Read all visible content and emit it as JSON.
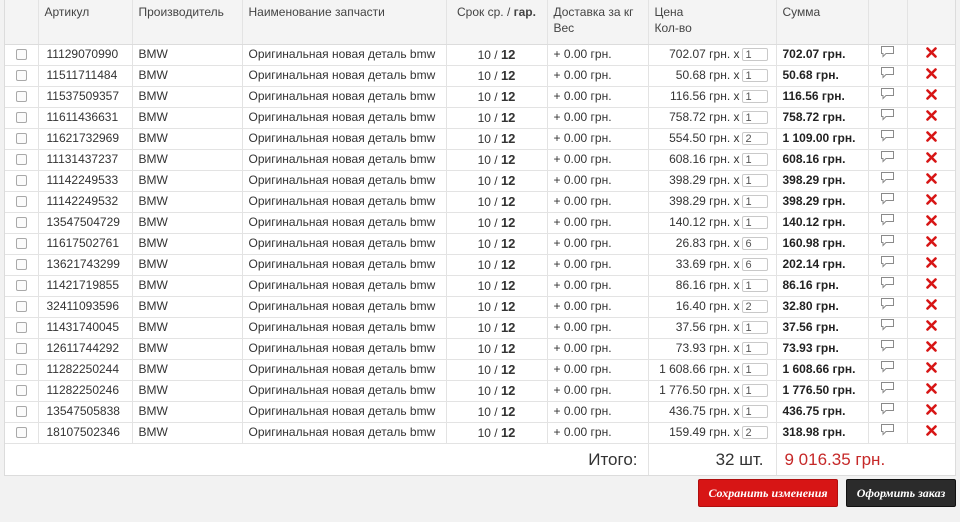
{
  "columns": {
    "article": "Артикул",
    "manufacturer": "Производитель",
    "name": "Наименование запчасти",
    "term_prefix": "Срок ср. / ",
    "term_bold": "гар.",
    "delivery": "Доставка за кг",
    "weight": "Вес",
    "price": "Цена",
    "qty": "Кол-во",
    "sum": "Сумма"
  },
  "rows": [
    {
      "article": "11129070990",
      "maker": "BMW",
      "name": "Оригинальная новая деталь bmw",
      "term_avg": "10",
      "term_gar": "12",
      "delivery": "+ 0.00 грн.",
      "price": "702.07 грн. x",
      "qty": "1",
      "sum": "702.07 грн."
    },
    {
      "article": "11511711484",
      "maker": "BMW",
      "name": "Оригинальная новая деталь bmw",
      "term_avg": "10",
      "term_gar": "12",
      "delivery": "+ 0.00 грн.",
      "price": "50.68 грн. x",
      "qty": "1",
      "sum": "50.68 грн."
    },
    {
      "article": "11537509357",
      "maker": "BMW",
      "name": "Оригинальная новая деталь bmw",
      "term_avg": "10",
      "term_gar": "12",
      "delivery": "+ 0.00 грн.",
      "price": "116.56 грн. x",
      "qty": "1",
      "sum": "116.56 грн."
    },
    {
      "article": "11611436631",
      "maker": "BMW",
      "name": "Оригинальная новая деталь bmw",
      "term_avg": "10",
      "term_gar": "12",
      "delivery": "+ 0.00 грн.",
      "price": "758.72 грн. x",
      "qty": "1",
      "sum": "758.72 грн."
    },
    {
      "article": "11621732969",
      "maker": "BMW",
      "name": "Оригинальная новая деталь bmw",
      "term_avg": "10",
      "term_gar": "12",
      "delivery": "+ 0.00 грн.",
      "price": "554.50 грн. x",
      "qty": "2",
      "sum": "1 109.00 грн."
    },
    {
      "article": "11131437237",
      "maker": "BMW",
      "name": "Оригинальная новая деталь bmw",
      "term_avg": "10",
      "term_gar": "12",
      "delivery": "+ 0.00 грн.",
      "price": "608.16 грн. x",
      "qty": "1",
      "sum": "608.16 грн."
    },
    {
      "article": "11142249533",
      "maker": "BMW",
      "name": "Оригинальная новая деталь bmw",
      "term_avg": "10",
      "term_gar": "12",
      "delivery": "+ 0.00 грн.",
      "price": "398.29 грн. x",
      "qty": "1",
      "sum": "398.29 грн."
    },
    {
      "article": "11142249532",
      "maker": "BMW",
      "name": "Оригинальная новая деталь bmw",
      "term_avg": "10",
      "term_gar": "12",
      "delivery": "+ 0.00 грн.",
      "price": "398.29 грн. x",
      "qty": "1",
      "sum": "398.29 грн."
    },
    {
      "article": "13547504729",
      "maker": "BMW",
      "name": "Оригинальная новая деталь bmw",
      "term_avg": "10",
      "term_gar": "12",
      "delivery": "+ 0.00 грн.",
      "price": "140.12 грн. x",
      "qty": "1",
      "sum": "140.12 грн."
    },
    {
      "article": "11617502761",
      "maker": "BMW",
      "name": "Оригинальная новая деталь bmw",
      "term_avg": "10",
      "term_gar": "12",
      "delivery": "+ 0.00 грн.",
      "price": "26.83 грн. x",
      "qty": "6",
      "sum": "160.98 грн."
    },
    {
      "article": "13621743299",
      "maker": "BMW",
      "name": "Оригинальная новая деталь bmw",
      "term_avg": "10",
      "term_gar": "12",
      "delivery": "+ 0.00 грн.",
      "price": "33.69 грн. x",
      "qty": "6",
      "sum": "202.14 грн."
    },
    {
      "article": "11421719855",
      "maker": "BMW",
      "name": "Оригинальная новая деталь bmw",
      "term_avg": "10",
      "term_gar": "12",
      "delivery": "+ 0.00 грн.",
      "price": "86.16 грн. x",
      "qty": "1",
      "sum": "86.16 грн."
    },
    {
      "article": "32411093596",
      "maker": "BMW",
      "name": "Оригинальная новая деталь bmw",
      "term_avg": "10",
      "term_gar": "12",
      "delivery": "+ 0.00 грн.",
      "price": "16.40 грн. x",
      "qty": "2",
      "sum": "32.80 грн."
    },
    {
      "article": "11431740045",
      "maker": "BMW",
      "name": "Оригинальная новая деталь bmw",
      "term_avg": "10",
      "term_gar": "12",
      "delivery": "+ 0.00 грн.",
      "price": "37.56 грн. x",
      "qty": "1",
      "sum": "37.56 грн."
    },
    {
      "article": "12611744292",
      "maker": "BMW",
      "name": "Оригинальная новая деталь bmw",
      "term_avg": "10",
      "term_gar": "12",
      "delivery": "+ 0.00 грн.",
      "price": "73.93 грн. x",
      "qty": "1",
      "sum": "73.93 грн."
    },
    {
      "article": "11282250244",
      "maker": "BMW",
      "name": "Оригинальная новая деталь bmw",
      "term_avg": "10",
      "term_gar": "12",
      "delivery": "+ 0.00 грн.",
      "price": "1 608.66 грн. x",
      "qty": "1",
      "sum": "1 608.66 грн."
    },
    {
      "article": "11282250246",
      "maker": "BMW",
      "name": "Оригинальная новая деталь bmw",
      "term_avg": "10",
      "term_gar": "12",
      "delivery": "+ 0.00 грн.",
      "price": "1 776.50 грн. x",
      "qty": "1",
      "sum": "1 776.50 грн."
    },
    {
      "article": "13547505838",
      "maker": "BMW",
      "name": "Оригинальная новая деталь bmw",
      "term_avg": "10",
      "term_gar": "12",
      "delivery": "+ 0.00 грн.",
      "price": "436.75 грн. x",
      "qty": "1",
      "sum": "436.75 грн."
    },
    {
      "article": "18107502346",
      "maker": "BMW",
      "name": "Оригинальная новая деталь bmw",
      "term_avg": "10",
      "term_gar": "12",
      "delivery": "+ 0.00 грн.",
      "price": "159.49 грн. x",
      "qty": "2",
      "sum": "318.98 грн."
    }
  ],
  "total": {
    "label": "Итого:",
    "qty": "32 шт.",
    "sum": "9 016.35 грн."
  },
  "buttons": {
    "save": "Сохранить изменения",
    "order": "Оформить заказ"
  },
  "icons": {
    "comment": "comment-icon",
    "delete": "delete-icon"
  },
  "colors": {
    "total_sum": "#c62828",
    "delete": "#d71515",
    "save_button": "#d71515",
    "order_button": "#2b2b2b"
  }
}
